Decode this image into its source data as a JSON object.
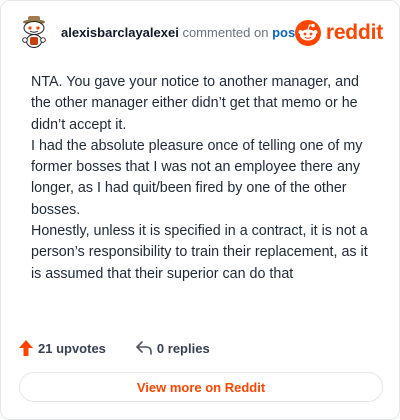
{
  "header": {
    "username": "alexisbarclayalexei",
    "action_text": "commented on",
    "post_link": "post",
    "brand_name": "reddit"
  },
  "comment": {
    "paragraphs": [
      "NTA. You gave your notice to another manager, and the other manager either didn’t get that memo or he didn’t accept it.",
      "I had the absolute pleasure once of telling one of my former bosses that I was not an employee there any longer, as I had quit/been fired by one of the other bosses.",
      "Honestly, unless it is specified in a contract, it is not a person’s responsibility to train their replacement, as it is assumed that their superior can do that"
    ]
  },
  "footer": {
    "upvotes": "21 upvotes",
    "replies": "0 replies",
    "cta": "View more on Reddit"
  },
  "colors": {
    "brand": "#ff4500",
    "link": "#0a66c2",
    "text": "#1f2937",
    "muted": "#6b7280"
  },
  "icons": {
    "avatar": "snoo-avatar-icon",
    "brand": "reddit-logo-icon",
    "upvote": "upvote-arrow-icon",
    "reply": "reply-icon"
  }
}
